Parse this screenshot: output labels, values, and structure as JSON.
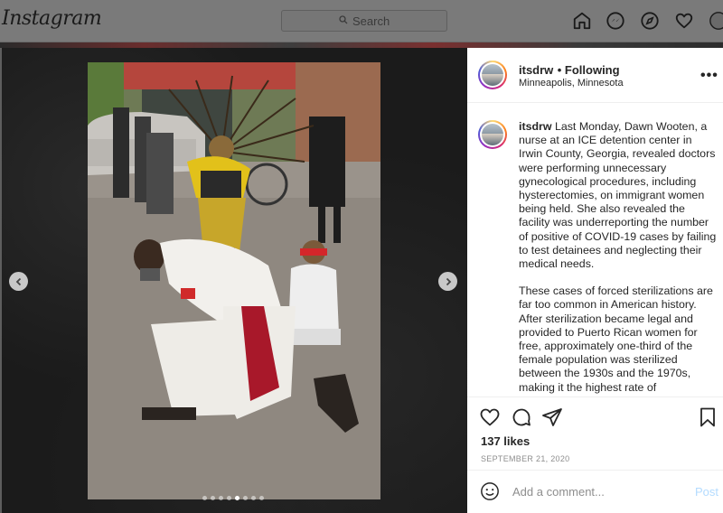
{
  "nav": {
    "logo": "Instagram",
    "search_placeholder": "Search",
    "icons": [
      "home-icon",
      "messenger-icon",
      "explore-icon",
      "activity-heart-icon",
      "profile-avatar-icon"
    ]
  },
  "post": {
    "username": "itsdrw",
    "follow_status": "• Following",
    "location": "Minneapolis, Minnesota",
    "more": "•••",
    "caption_username": "itsdrw",
    "caption_p1": "Last Monday, Dawn Wooten, a nurse at an ICE detention center in Irwin County, Georgia, revealed doctors were performing unnecessary gynecological procedures, including hysterectomies, on immigrant women being held. She also revealed the facility was underreporting the number of positive of COVID-19 cases by failing to test detainees and neglecting their medical needs.",
    "caption_p2": "These cases of forced sterilizations are far too common in American history. After sterilization became legal and provided to Puerto Rican women for free, approximately one-third of the female population was sterilized between the 1930s and the 1970s, making it the highest rate of",
    "likes": "137 likes",
    "date": "SEPTEMBER 21, 2020",
    "comment_placeholder": "Add a comment...",
    "post_button": "Post",
    "carousel": {
      "total": 8,
      "active_index": 4
    }
  },
  "colors": {
    "link_blue_disabled": "#b3dbff",
    "meta_gray": "#8e8e8e",
    "text": "#262626"
  }
}
